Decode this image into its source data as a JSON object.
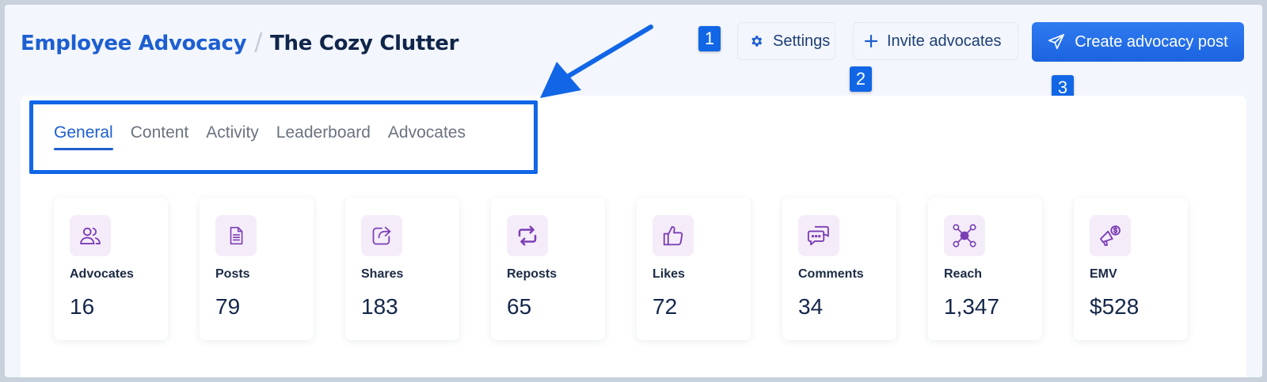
{
  "breadcrumb": {
    "root": "Employee Advocacy",
    "separator": "/",
    "current": "The Cozy Clutter"
  },
  "actions": {
    "settings_label": "Settings",
    "invite_label": "Invite advocates",
    "create_label": "Create advocacy post"
  },
  "markers": [
    "1",
    "2",
    "3"
  ],
  "tabs": [
    {
      "label": "General",
      "active": true
    },
    {
      "label": "Content"
    },
    {
      "label": "Activity"
    },
    {
      "label": "Leaderboard"
    },
    {
      "label": "Advocates"
    }
  ],
  "stats": [
    {
      "label": "Advocates",
      "value": "16",
      "icon": "users-icon"
    },
    {
      "label": "Posts",
      "value": "79",
      "icon": "document-icon"
    },
    {
      "label": "Shares",
      "value": "183",
      "icon": "share-icon"
    },
    {
      "label": "Reposts",
      "value": "65",
      "icon": "repost-icon"
    },
    {
      "label": "Likes",
      "value": "72",
      "icon": "thumbs-up-icon"
    },
    {
      "label": "Comments",
      "value": "34",
      "icon": "comments-icon"
    },
    {
      "label": "Reach",
      "value": "1,347",
      "icon": "network-icon"
    },
    {
      "label": "EMV",
      "value": "$528",
      "icon": "megaphone-dollar-icon"
    }
  ],
  "colors": {
    "accent": "#1d5fd1",
    "annotation": "#1166e6",
    "icon_purple": "#7b3fb5",
    "icon_bg": "#f5ecf9"
  }
}
